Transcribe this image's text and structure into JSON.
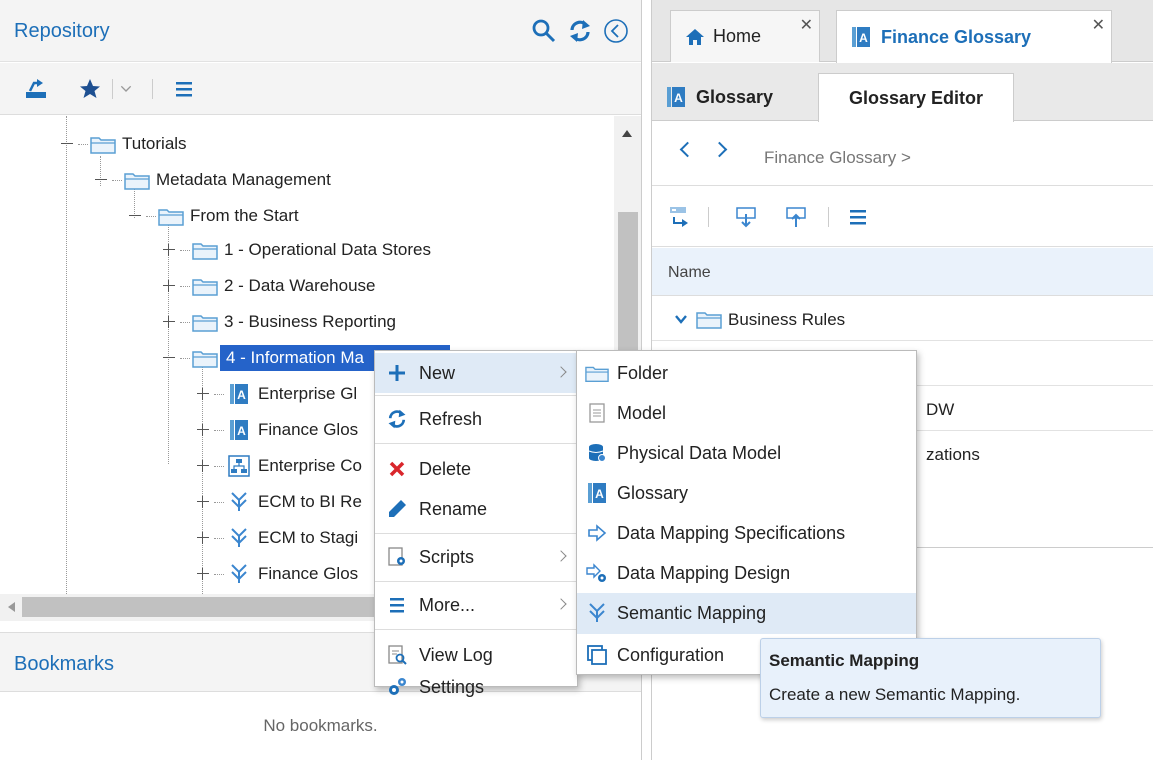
{
  "colors": {
    "accent": "#1d6fb8",
    "selection": "#2563c9",
    "folder": "#5a9fd4",
    "delete_red": "#d9262c",
    "star": "#1d4f91"
  },
  "repository": {
    "title": "Repository",
    "header_icons": [
      "search-icon",
      "refresh-icon",
      "collapse-left-icon"
    ],
    "toolbar_icons": [
      "import-icon",
      "bookmark-star-icon",
      "dropdown-chevron-icon",
      "menu-lines-icon"
    ]
  },
  "tree": {
    "items": [
      {
        "label": "Tutorials",
        "icon": "folder-icon"
      },
      {
        "label": "Metadata Management",
        "icon": "folder-icon"
      },
      {
        "label": "From the Start",
        "icon": "folder-icon"
      },
      {
        "label": "1 - Operational Data Stores",
        "icon": "folder-icon"
      },
      {
        "label": "2 - Data Warehouse",
        "icon": "folder-icon"
      },
      {
        "label": "3 - Business Reporting",
        "icon": "folder-icon"
      },
      {
        "label": "4 - Information Ma",
        "icon": "folder-icon"
      },
      {
        "label": "Enterprise Gl",
        "icon": "glossary-icon"
      },
      {
        "label": "Finance Glos",
        "icon": "glossary-icon"
      },
      {
        "label": "Enterprise Co",
        "icon": "configuration-icon"
      },
      {
        "label": "ECM to BI Re",
        "icon": "semantic-mapping-icon"
      },
      {
        "label": "ECM to Stagi",
        "icon": "semantic-mapping-icon"
      },
      {
        "label": "Finance Glos",
        "icon": "semantic-mapping-icon"
      }
    ]
  },
  "bookmarks": {
    "title": "Bookmarks",
    "empty_text": "No bookmarks."
  },
  "tabs": [
    {
      "label": "Home",
      "icon": "home-icon"
    },
    {
      "label": "Finance Glossary",
      "icon": "glossary-icon"
    }
  ],
  "subtabs": [
    {
      "label": "Glossary"
    },
    {
      "label": "Glossary Editor"
    }
  ],
  "breadcrumb": "Finance Glossary >",
  "editor_toolbar_icons": [
    "move-icon",
    "move-down-icon",
    "move-up-icon",
    "menu-lines-icon"
  ],
  "grid": {
    "column": "Name",
    "rows": [
      "Business Rules",
      "DW",
      "zations"
    ]
  },
  "context_menu": {
    "items": [
      {
        "label": "New",
        "icon": "plus-icon",
        "has_submenu": true
      },
      {
        "label": "Refresh",
        "icon": "refresh-icon",
        "has_submenu": false
      },
      {
        "label": "Delete",
        "icon": "delete-x-icon",
        "has_submenu": false
      },
      {
        "label": "Rename",
        "icon": "pencil-icon",
        "has_submenu": false
      },
      {
        "label": "Scripts",
        "icon": "scripts-icon",
        "has_submenu": true
      },
      {
        "label": "More...",
        "icon": "menu-lines-icon",
        "has_submenu": true
      },
      {
        "label": "View Log",
        "icon": "view-log-icon",
        "has_submenu": false
      },
      {
        "label": "Settings",
        "icon": "gears-icon",
        "has_submenu": false
      }
    ]
  },
  "submenu": {
    "items": [
      {
        "label": "Folder",
        "icon": "folder-icon"
      },
      {
        "label": "Model",
        "icon": "model-icon"
      },
      {
        "label": "Physical Data Model",
        "icon": "database-icon"
      },
      {
        "label": "Glossary",
        "icon": "glossary-icon"
      },
      {
        "label": "Data Mapping Specifications",
        "icon": "data-mapping-icon"
      },
      {
        "label": "Data Mapping Design",
        "icon": "data-mapping-design-icon"
      },
      {
        "label": "Semantic Mapping",
        "icon": "semantic-mapping-icon"
      },
      {
        "label": "Configuration",
        "icon": "configuration-icon"
      }
    ],
    "highlighted": "Semantic Mapping"
  },
  "tooltip": {
    "title": "Semantic Mapping",
    "body": "Create a new Semantic Mapping."
  }
}
